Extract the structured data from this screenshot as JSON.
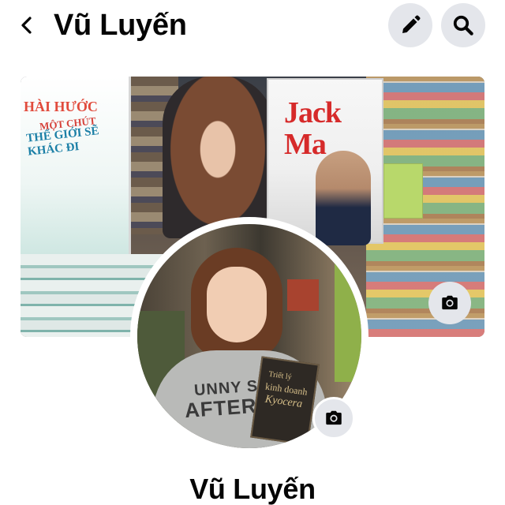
{
  "header": {
    "title": "Vũ Luyến",
    "back_icon": "chevron-left-icon",
    "edit_icon": "pencil-icon",
    "search_icon": "search-icon"
  },
  "cover": {
    "book_left": {
      "line1": "HÀI HƯỚC",
      "line2": "MỘT CHÚT",
      "line3": "THẾ GIỚI SẼ KHÁC ĐI",
      "line4": "ĐI"
    },
    "book_jack": {
      "title_line1": "Jack",
      "title_line2": "Ma"
    },
    "camera_icon": "camera-icon"
  },
  "avatar": {
    "shirt_line1": "UNNY SIDE",
    "shirt_line2": "AFTER",
    "book_line1": "Triết lý",
    "book_line2": "kinh doanh",
    "book_line3": "Kyocera",
    "camera_icon": "camera-icon"
  },
  "profile": {
    "name": "Vũ Luyến"
  },
  "colors": {
    "button_bg": "#e4e6eb",
    "text": "#050505",
    "background": "#ffffff"
  }
}
